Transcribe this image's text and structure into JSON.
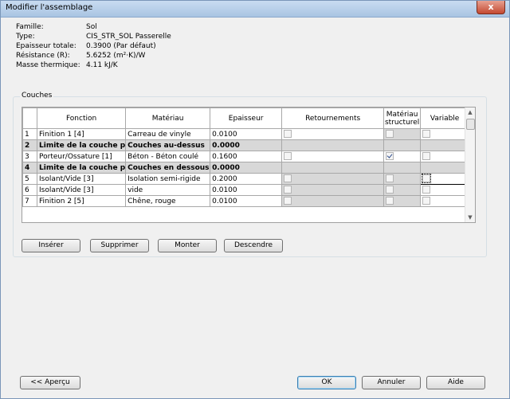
{
  "window": {
    "title": "Modifier l'assemblage",
    "close_label": "x"
  },
  "properties": [
    {
      "label": "Famille:",
      "value": "Sol"
    },
    {
      "label": "Type:",
      "value": "CIS_STR_SOL Passerelle"
    },
    {
      "label": "Epaisseur totale:",
      "value": "0.3900 (Par défaut)"
    },
    {
      "label": "Résistance (R):",
      "value": "5.6252 (m²·K)/W"
    },
    {
      "label": "Masse thermique:",
      "value": "4.11 kJ/K"
    }
  ],
  "layers": {
    "group_label": "Couches",
    "columns": {
      "fonction": "Fonction",
      "materiau": "Matériau",
      "epaisseur": "Epaisseur",
      "retournements": "Retournements",
      "structurel": [
        "Matériau",
        "structurel"
      ],
      "variable": "Variable"
    },
    "rows": [
      {
        "num": "1",
        "fonction": "Finition 1 [4]",
        "materiau": "Carreau de vinyle",
        "epaisseur": "0.0100",
        "bold": false,
        "retour": false,
        "structurel": false,
        "structurel_enabled": false,
        "variable": false
      },
      {
        "num": "2",
        "fonction": "Limite de la couche p",
        "materiau": "Couches au-dessus",
        "epaisseur": "0.0000",
        "bold": true
      },
      {
        "num": "3",
        "fonction": "Porteur/Ossature [1]",
        "materiau": "Béton - Béton coulé",
        "epaisseur": "0.1600",
        "bold": false,
        "retour": false,
        "structurel": true,
        "structurel_enabled": true,
        "variable": false
      },
      {
        "num": "4",
        "fonction": "Limite de la couche p",
        "materiau": "Couches en dessous",
        "epaisseur": "0.0000",
        "bold": true
      },
      {
        "num": "5",
        "fonction": "Isolant/Vide [3]",
        "materiau": "Isolation semi-rigide",
        "epaisseur": "0.2000",
        "bold": false,
        "retour": false,
        "structurel": false,
        "structurel_enabled": false,
        "variable": false,
        "variable_focused": true
      },
      {
        "num": "6",
        "fonction": "Isolant/Vide [3]",
        "materiau": "vide",
        "epaisseur": "0.0100",
        "bold": false,
        "retour": false,
        "structurel": false,
        "structurel_enabled": false,
        "variable": false
      },
      {
        "num": "7",
        "fonction": "Finition 2 [5]",
        "materiau": "Chêne, rouge",
        "epaisseur": "0.0100",
        "bold": false,
        "retour": false,
        "structurel": false,
        "structurel_enabled": false,
        "variable": false
      }
    ]
  },
  "layer_buttons": {
    "insert": "Insérer",
    "delete": "Supprimer",
    "up": "Monter",
    "down": "Descendre"
  },
  "footer": {
    "preview": "<< Aperçu",
    "ok": "OK",
    "cancel": "Annuler",
    "help": "Aide"
  }
}
